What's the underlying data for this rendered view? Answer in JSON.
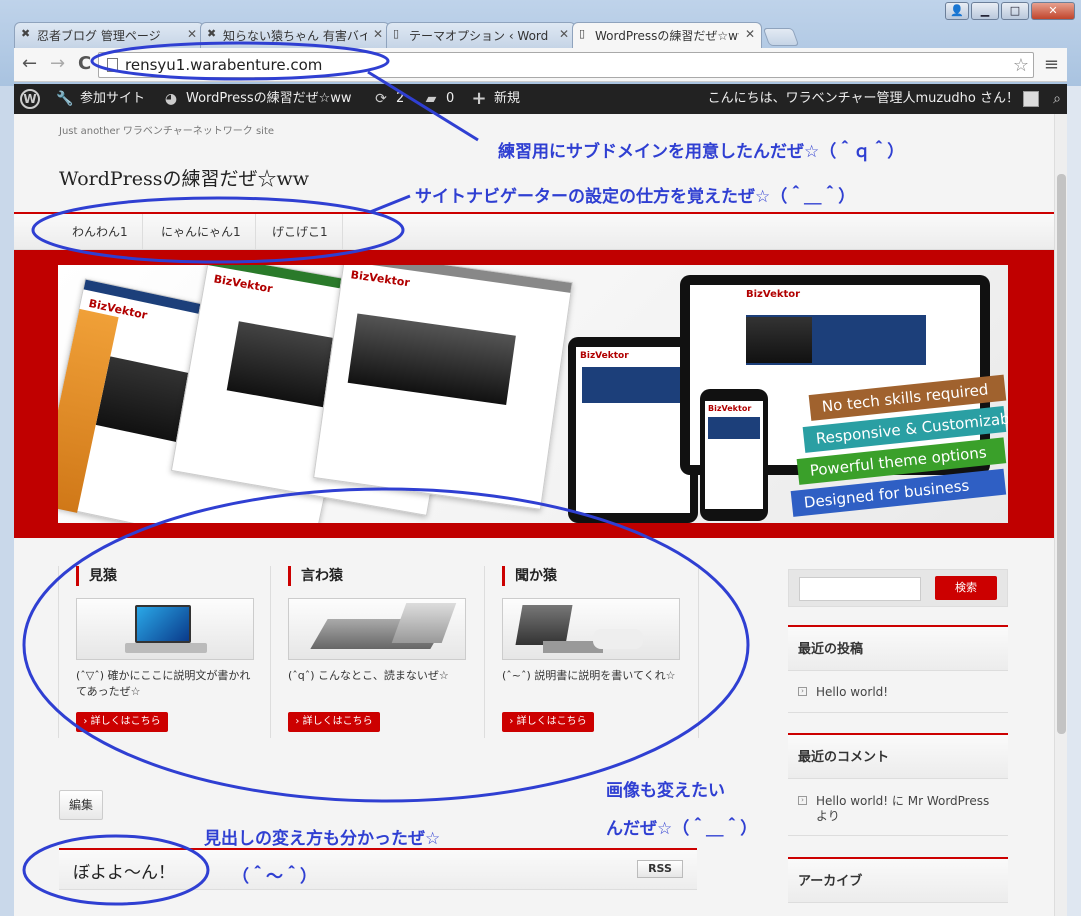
{
  "window": {
    "user_btn": "👤",
    "minimize": "▁",
    "maximize": "□",
    "close": "✕"
  },
  "tabs": [
    {
      "title": "忍者ブログ 管理ページ",
      "icon": "ninja-icon"
    },
    {
      "title": "知らない猿ちゃん 有害バイ",
      "icon": "ninja-icon"
    },
    {
      "title": "テーマオプション ‹ Word",
      "icon": "page-icon"
    },
    {
      "title": "WordPressの練習だぜ☆ww",
      "icon": "page-icon",
      "active": true
    }
  ],
  "toolbar": {
    "back": "←",
    "forward": "→",
    "reload": "C",
    "url": "rensyu1.warabenture.com",
    "star": "☆",
    "menu": "≡"
  },
  "adminbar": {
    "wp_logo": "W",
    "my_sites": "参加サイト",
    "site_name": "WordPressの練習だぜ☆ww",
    "updates_count": "2",
    "comments_count": "0",
    "new_label": "新規",
    "greeting": "こんにちは、ワラベンチャー管理人muzudho さん！"
  },
  "site": {
    "tagline": "Just another ワラベンチャーネットワーク site",
    "title": "WordPressの練習だぜ☆ww",
    "nav": [
      "わんわん1",
      "にゃんにゃん1",
      "げこげこ1"
    ]
  },
  "hero": {
    "brand": "BizVektor",
    "ribbons": [
      {
        "text": "No tech skills required",
        "color": "#a0622e"
      },
      {
        "text": "Responsive & Customizable",
        "color": "#2a9fa3"
      },
      {
        "text": "Powerful theme options",
        "color": "#3aa02a"
      },
      {
        "text": "Designed for business",
        "color": "#2f5fc4"
      }
    ]
  },
  "pr_blocks": [
    {
      "title": "見猿",
      "text": "(ˆ▽ˆ) 確かにここに説明文が書かれてあったぜ☆",
      "button": "詳しくはこちら"
    },
    {
      "title": "言わ猿",
      "text": "(ˆqˆ) こんなとこ、読まないぜ☆",
      "button": "詳しくはこちら"
    },
    {
      "title": "聞か猿",
      "text": "(ˆ~ˆ) 説明書に説明を書いてくれ☆",
      "button": "詳しくはこちら"
    }
  ],
  "edit_button": "編集",
  "subsection": {
    "title": "ぼよよ〜ん！",
    "rss": "RSS"
  },
  "sidebar": {
    "search_button": "検索",
    "recent_posts_title": "最近の投稿",
    "recent_posts": [
      "Hello world!"
    ],
    "recent_comments_title": "最近のコメント",
    "recent_comments": [
      "Hello world! に Mr WordPress より"
    ],
    "archives_title": "アーカイブ"
  },
  "annotations": {
    "subdomain": "練習用にサブドメインを用意したんだぜ☆（＾ｑ＾）",
    "navigator": "サイトナビゲーターの設定の仕方を覚えたぜ☆（＾＿＾）",
    "image_line1": "画像も変えたい",
    "image_line2": "んだぜ☆（＾＿＾）",
    "heading_line1": "見出しの変え方も分かったぜ☆",
    "heading_line2": "（＾～＾）",
    "color": "#2f3fd2"
  }
}
